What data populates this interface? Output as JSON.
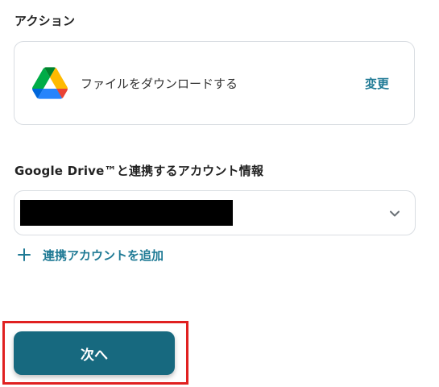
{
  "action_section": {
    "label": "アクション",
    "action_text": "ファイルをダウンロードする",
    "change_label": "変更",
    "app_icon": "google-drive-icon"
  },
  "account_section": {
    "label": "Google Drive™と連携するアカウント情報",
    "chevron_icon": "chevron-down-icon",
    "add_account_label": "連携アカウントを追加",
    "add_icon": "plus-icon"
  },
  "footer": {
    "next_label": "次へ"
  },
  "colors": {
    "accent": "#17697f",
    "link": "#1f7a95",
    "highlight": "#e02020"
  }
}
